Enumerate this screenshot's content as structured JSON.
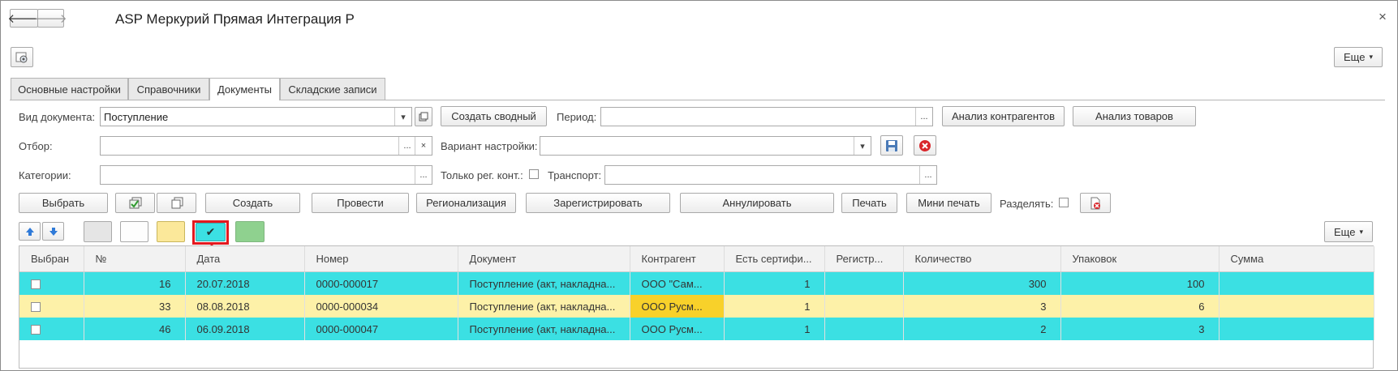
{
  "window": {
    "title": "ASP Меркурий Прямая Интеграция Р",
    "back_glyph": "🡐",
    "forward_glyph": "🡒",
    "close_glyph": "×",
    "more_label": "Еще"
  },
  "tabs": [
    {
      "label": "Основные настройки",
      "active": false
    },
    {
      "label": "Справочники",
      "active": false
    },
    {
      "label": "Документы",
      "active": true
    },
    {
      "label": "Складские записи",
      "active": false
    }
  ],
  "filters": {
    "doc_type_label": "Вид документа:",
    "doc_type_value": "Поступление",
    "create_summary_label": "Создать сводный",
    "period_label": "Период:",
    "period_value": "",
    "analysis_contractors_label": "Анализ контрагентов",
    "analysis_goods_label": "Анализ товаров",
    "selection_label": "Отбор:",
    "selection_value": "",
    "setting_variant_label": "Вариант настройки:",
    "setting_variant_value": "",
    "categories_label": "Категории:",
    "categories_value": "",
    "only_reg_label": "Только рег. конт.:",
    "transport_label": "Транспорт:",
    "transport_value": ""
  },
  "toolbar": {
    "select_label": "Выбрать",
    "create_label": "Создать",
    "post_label": "Провести",
    "regionalize_label": "Регионализация",
    "register_label": "Зарегистрировать",
    "cancel_label": "Аннулировать",
    "print_label": "Печать",
    "mini_print_label": "Мини печать",
    "split_label": "Разделять:",
    "more_label": "Еще",
    "checked_glyph": "✔"
  },
  "colors": {
    "cyan_row": "#3be0e3",
    "yellow_row": "#fdf1a8",
    "yellow_highlight": "#f8d12a",
    "green_swatch": "#8fd18f",
    "annotation_red": "#e3191f"
  },
  "table": {
    "columns": [
      "Выбран",
      "№",
      "Дата",
      "Номер",
      "Документ",
      "Контрагент",
      "Есть сертифи...",
      "Регистр...",
      "Количество",
      "Упаковок",
      "Сумма"
    ],
    "rows": [
      {
        "selected": "",
        "num": "16",
        "date": "20.07.2018",
        "number": "0000-000017",
        "document": "Поступление (акт, накладна...",
        "contractor": "ООО \"Сам...",
        "cert": "1",
        "reg": "",
        "qty": "300",
        "packs": "100",
        "sum": "",
        "color": "cyan"
      },
      {
        "selected": "",
        "num": "33",
        "date": "08.08.2018",
        "number": "0000-000034",
        "document": "Поступление (акт, накладна...",
        "contractor": "ООО Русм...",
        "cert": "1",
        "reg": "",
        "qty": "3",
        "packs": "6",
        "sum": "",
        "color": "yellow"
      },
      {
        "selected": "",
        "num": "46",
        "date": "06.09.2018",
        "number": "0000-000047",
        "document": "Поступление (акт, накладна...",
        "contractor": "ООО Русм...",
        "cert": "1",
        "reg": "",
        "qty": "2",
        "packs": "3",
        "sum": "",
        "color": "cyan"
      }
    ]
  }
}
